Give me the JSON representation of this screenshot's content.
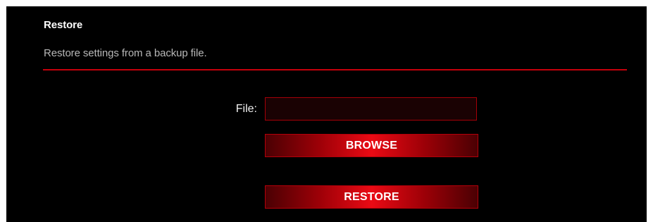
{
  "section": {
    "title": "Restore",
    "description": "Restore settings from a backup file."
  },
  "file_field": {
    "label": "File:",
    "value": ""
  },
  "buttons": {
    "browse": "BROWSE",
    "restore": "RESTORE"
  },
  "colors": {
    "background": "#000000",
    "accent": "#c4000b",
    "title_text": "#ffffff",
    "description_text": "#b8b8b8"
  }
}
